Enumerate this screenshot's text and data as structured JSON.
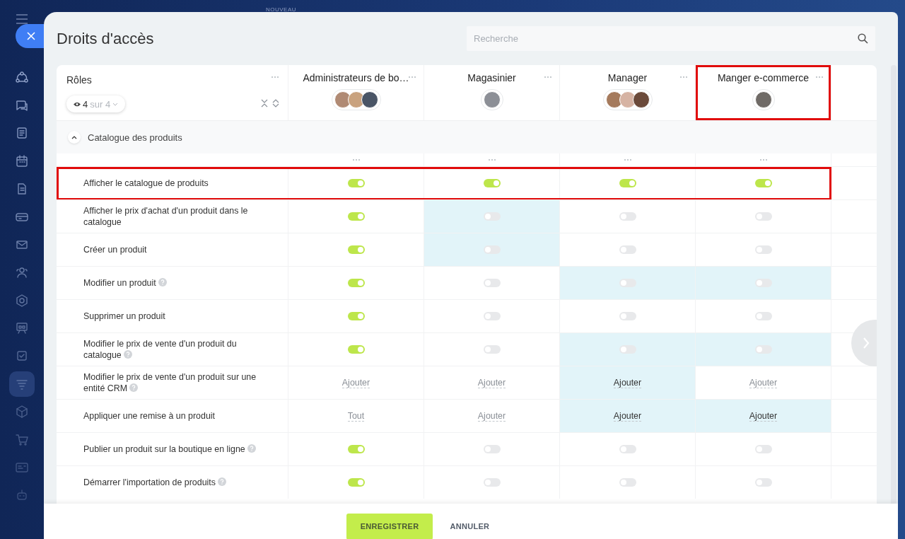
{
  "top_bar": {
    "badge": "NOUVEAU"
  },
  "sidebar": {
    "items": [
      {
        "selected": false
      },
      {
        "selected": false
      },
      {
        "selected": false
      },
      {
        "selected": false
      },
      {
        "selected": false
      },
      {
        "selected": false
      },
      {
        "selected": false
      },
      {
        "selected": false
      },
      {
        "selected": false
      },
      {
        "selected": false
      },
      {
        "selected": false
      },
      {
        "selected": true
      },
      {
        "selected": false
      },
      {
        "selected": false
      },
      {
        "selected": false
      },
      {
        "selected": false
      }
    ]
  },
  "panel": {
    "title": "Droits d'accès",
    "search": {
      "placeholder": "Recherche"
    }
  },
  "table": {
    "roles_header": {
      "label": "Rôles",
      "filter_count": "4",
      "filter_total": "sur 4"
    },
    "columns": [
      {
        "name": "Administrateurs de bo…",
        "outlined": false,
        "avatars": [
          {
            "color": "#b08a74"
          },
          {
            "color": "#c9a27e"
          },
          {
            "color": "#4a5566"
          }
        ]
      },
      {
        "name": "Magasinier",
        "outlined": false,
        "avatars": [
          {
            "color": "#8c8f96"
          }
        ]
      },
      {
        "name": "Manager",
        "outlined": false,
        "avatars": [
          {
            "color": "#a57a5c"
          },
          {
            "color": "#d6b3a3"
          },
          {
            "color": "#6b4a3a"
          }
        ]
      },
      {
        "name": "Manger e-commerce",
        "outlined": true,
        "avatars": [
          {
            "color": "#6f6a66"
          }
        ]
      }
    ],
    "section": {
      "title": "Catalogue des produits",
      "expanded": true
    },
    "rows": [
      {
        "label": "Afficher le catalogue de produits",
        "help": false,
        "outlined": true,
        "cells": [
          {
            "kind": "toggle",
            "on": true,
            "highlighted": false
          },
          {
            "kind": "toggle",
            "on": true,
            "highlighted": false
          },
          {
            "kind": "toggle",
            "on": true,
            "highlighted": false
          },
          {
            "kind": "toggle",
            "on": true,
            "highlighted": false
          }
        ]
      },
      {
        "label": "Afficher le prix d'achat d'un produit dans le catalogue",
        "help": false,
        "outlined": false,
        "cells": [
          {
            "kind": "toggle",
            "on": true,
            "highlighted": false
          },
          {
            "kind": "toggle",
            "on": false,
            "highlighted": true
          },
          {
            "kind": "toggle",
            "on": false,
            "highlighted": false
          },
          {
            "kind": "toggle",
            "on": false,
            "highlighted": false
          }
        ]
      },
      {
        "label": "Créer un produit",
        "help": false,
        "outlined": false,
        "cells": [
          {
            "kind": "toggle",
            "on": true,
            "highlighted": false
          },
          {
            "kind": "toggle",
            "on": false,
            "highlighted": true
          },
          {
            "kind": "toggle",
            "on": false,
            "highlighted": false
          },
          {
            "kind": "toggle",
            "on": false,
            "highlighted": false
          }
        ]
      },
      {
        "label": "Modifier un produit",
        "help": true,
        "outlined": false,
        "cells": [
          {
            "kind": "toggle",
            "on": true,
            "highlighted": false
          },
          {
            "kind": "toggle",
            "on": false,
            "highlighted": false
          },
          {
            "kind": "toggle",
            "on": false,
            "highlighted": true
          },
          {
            "kind": "toggle",
            "on": false,
            "highlighted": true
          }
        ]
      },
      {
        "label": "Supprimer un produit",
        "help": false,
        "outlined": false,
        "cells": [
          {
            "kind": "toggle",
            "on": true,
            "highlighted": false
          },
          {
            "kind": "toggle",
            "on": false,
            "highlighted": false
          },
          {
            "kind": "toggle",
            "on": false,
            "highlighted": false
          },
          {
            "kind": "toggle",
            "on": false,
            "highlighted": false
          }
        ]
      },
      {
        "label": "Modifier le prix de vente d'un produit du catalogue",
        "help": true,
        "outlined": false,
        "cells": [
          {
            "kind": "toggle",
            "on": true,
            "highlighted": false
          },
          {
            "kind": "toggle",
            "on": false,
            "highlighted": false
          },
          {
            "kind": "toggle",
            "on": false,
            "highlighted": true
          },
          {
            "kind": "toggle",
            "on": false,
            "highlighted": true
          }
        ]
      },
      {
        "label": "Modifier le prix de vente d'un produit sur une entité CRM",
        "help": true,
        "outlined": false,
        "cells": [
          {
            "kind": "link",
            "text": "Ajouter",
            "highlighted": false
          },
          {
            "kind": "link",
            "text": "Ajouter",
            "highlighted": false
          },
          {
            "kind": "link",
            "text": "Ajouter",
            "highlighted": true
          },
          {
            "kind": "link",
            "text": "Ajouter",
            "highlighted": false
          }
        ]
      },
      {
        "label": "Appliquer une remise à un produit",
        "help": false,
        "outlined": false,
        "cells": [
          {
            "kind": "link",
            "text": "Tout",
            "highlighted": false
          },
          {
            "kind": "link",
            "text": "Ajouter",
            "highlighted": false
          },
          {
            "kind": "link",
            "text": "Ajouter",
            "highlighted": true
          },
          {
            "kind": "link",
            "text": "Ajouter",
            "highlighted": true
          }
        ]
      },
      {
        "label": "Publier un produit sur la boutique en ligne",
        "help": true,
        "outlined": false,
        "cells": [
          {
            "kind": "toggle",
            "on": true,
            "highlighted": false
          },
          {
            "kind": "toggle",
            "on": false,
            "highlighted": false
          },
          {
            "kind": "toggle",
            "on": false,
            "highlighted": false
          },
          {
            "kind": "toggle",
            "on": false,
            "highlighted": false
          }
        ]
      },
      {
        "label": "Démarrer l'importation de produits",
        "help": true,
        "outlined": false,
        "cells": [
          {
            "kind": "toggle",
            "on": true,
            "highlighted": false
          },
          {
            "kind": "toggle",
            "on": false,
            "highlighted": false
          },
          {
            "kind": "toggle",
            "on": false,
            "highlighted": false
          },
          {
            "kind": "toggle",
            "on": false,
            "highlighted": false
          }
        ]
      }
    ]
  },
  "footer": {
    "buttons": [
      {
        "label": "ENREGISTRER",
        "kind": "primary"
      },
      {
        "label": "ANNULER",
        "kind": "plain"
      }
    ]
  }
}
